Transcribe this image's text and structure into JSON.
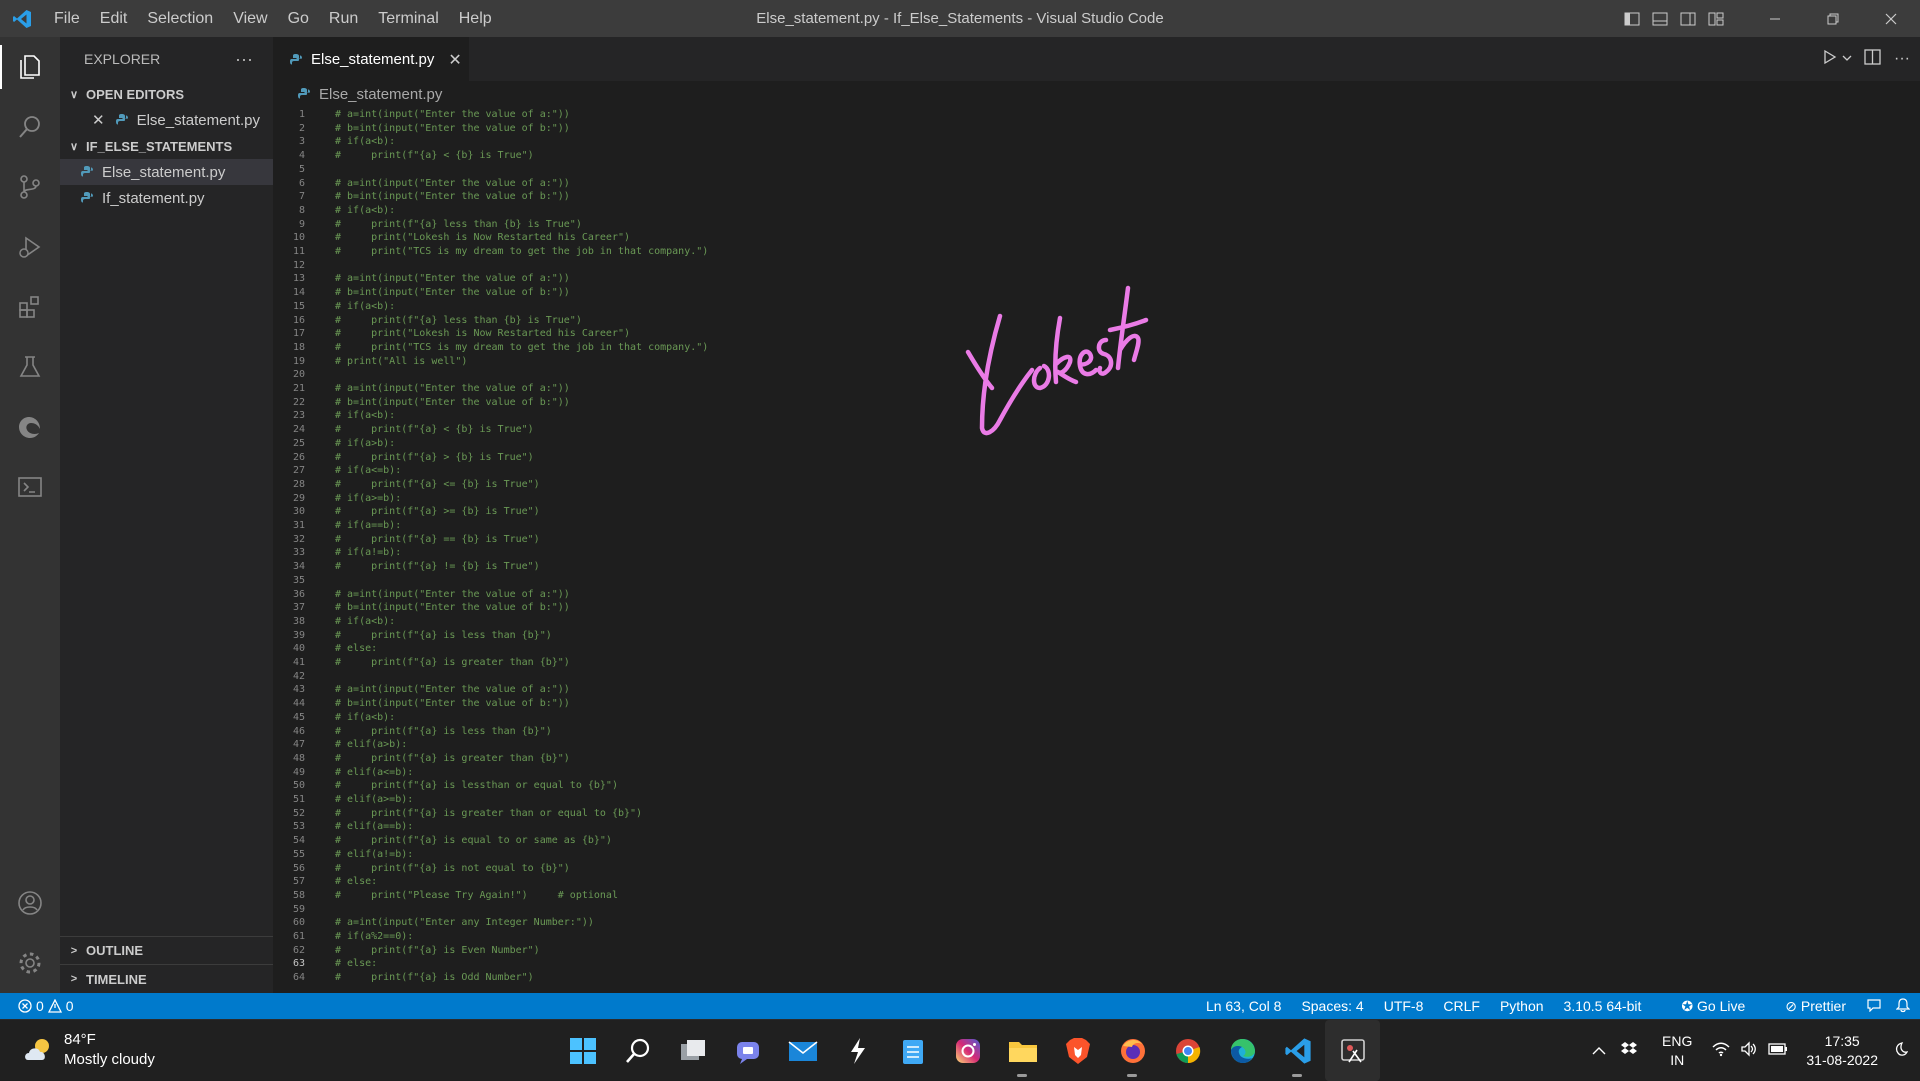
{
  "titlebar": {
    "menu": [
      "File",
      "Edit",
      "Selection",
      "View",
      "Go",
      "Run",
      "Terminal",
      "Help"
    ],
    "title": "Else_statement.py - If_Else_Statements - Visual Studio Code"
  },
  "sidebar": {
    "header": "EXPLORER",
    "more": "···",
    "open_editors_label": "OPEN EDITORS",
    "open_editors": [
      "Else_statement.py"
    ],
    "folder_label": "IF_ELSE_STATEMENTS",
    "files": [
      "Else_statement.py",
      "If_statement.py"
    ],
    "outline_label": "OUTLINE",
    "timeline_label": "TIMELINE"
  },
  "tab": {
    "label": "Else_statement.py",
    "close": "✕"
  },
  "breadcrumb": "Else_statement.py",
  "editor": {
    "current_line": 63,
    "lines": [
      "# a=int(input(\"Enter the value of a:\"))",
      "# b=int(input(\"Enter the value of b:\"))",
      "# if(a<b):",
      "#     print(f\"{a} < {b} is True\")",
      "",
      "# a=int(input(\"Enter the value of a:\"))",
      "# b=int(input(\"Enter the value of b:\"))",
      "# if(a<b):",
      "#     print(f\"{a} less than {b} is True\")",
      "#     print(\"Lokesh is Now Restarted his Career\")",
      "#     print(\"TCS is my dream to get the job in that company.\")",
      "",
      "# a=int(input(\"Enter the value of a:\"))",
      "# b=int(input(\"Enter the value of b:\"))",
      "# if(a<b):",
      "#     print(f\"{a} less than {b} is True\")",
      "#     print(\"Lokesh is Now Restarted his Career\")",
      "#     print(\"TCS is my dream to get the job in that company.\")",
      "# print(\"All is well\")",
      "",
      "# a=int(input(\"Enter the value of a:\"))",
      "# b=int(input(\"Enter the value of b:\"))",
      "# if(a<b):",
      "#     print(f\"{a} < {b} is True\")",
      "# if(a>b):",
      "#     print(f\"{a} > {b} is True\")",
      "# if(a<=b):",
      "#     print(f\"{a} <= {b} is True\")",
      "# if(a>=b):",
      "#     print(f\"{a} >= {b} is True\")",
      "# if(a==b):",
      "#     print(f\"{a} == {b} is True\")",
      "# if(a!=b):",
      "#     print(f\"{a} != {b} is True\")",
      "",
      "# a=int(input(\"Enter the value of a:\"))",
      "# b=int(input(\"Enter the value of b:\"))",
      "# if(a<b):",
      "#     print(f\"{a} is less than {b}\")",
      "# else:",
      "#     print(f\"{a} is greater than {b}\")",
      "",
      "# a=int(input(\"Enter the value of a:\"))",
      "# b=int(input(\"Enter the value of b:\"))",
      "# if(a<b):",
      "#     print(f\"{a} is less than {b}\")",
      "# elif(a>b):",
      "#     print(f\"{a} is greater than {b}\")",
      "# elif(a<=b):",
      "#     print(f\"{a} is lessthan or equal to {b}\")",
      "# elif(a>=b):",
      "#     print(f\"{a} is greater than or equal to {b}\")",
      "# elif(a==b):",
      "#     print(f\"{a} is equal to or same as {b}\")",
      "# elif(a!=b):",
      "#     print(f\"{a} is not equal to {b}\")",
      "# else:",
      "#     print(\"Please Try Again!\")     # optional",
      "",
      "# a=int(input(\"Enter any Integer Number:\"))",
      "# if(a%2==0):",
      "#     print(f\"{a} is Even Number\")",
      "# else:",
      "#     print(f\"{a} is Odd Number\")"
    ]
  },
  "signature": "Lokesh",
  "statusbar": {
    "errors": "0",
    "warnings": "0",
    "position": "Ln 63, Col 8",
    "spaces": "Spaces: 4",
    "encoding": "UTF-8",
    "eol": "CRLF",
    "language": "Python",
    "interpreter": "3.10.5 64-bit",
    "go_live": "Go Live",
    "prettier": "Prettier"
  },
  "taskbar": {
    "temperature": "84°F",
    "weather": "Mostly cloudy",
    "language": "ENG",
    "region": "IN",
    "time": "17:35",
    "date": "31-08-2022"
  },
  "colors": {
    "accent": "#007acc",
    "comment": "#6a9955",
    "python_icon": "#519aba",
    "signature": "#ea7be6"
  }
}
